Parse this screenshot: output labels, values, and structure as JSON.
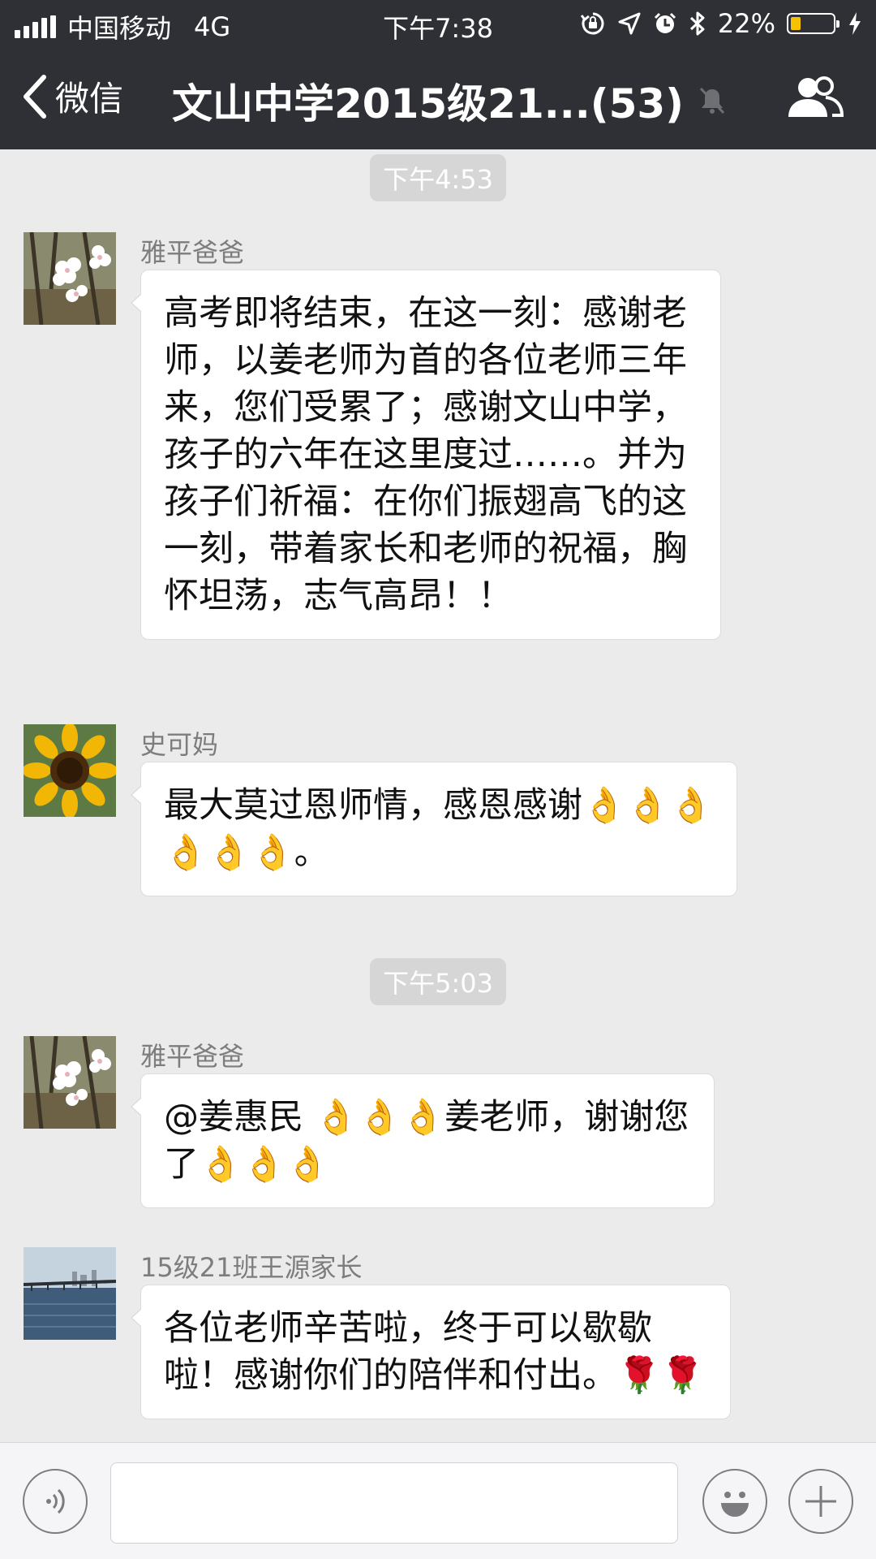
{
  "status_bar": {
    "carrier": "中国移动",
    "network": "4G",
    "time": "下午7:38",
    "battery": "22%",
    "battery_level": 0.22
  },
  "nav": {
    "back_label": "微信",
    "title": "文山中学2015级21...(53)"
  },
  "chat": {
    "timestamps": [
      "下午4:53",
      "下午5:03"
    ],
    "messages": [
      {
        "sender": "雅平爸爸",
        "text": "高考即将结束，在这一刻：感谢老师，以姜老师为首的各位老师三年来，您们受累了；感谢文山中学，孩子的六年在这里度过……。并为孩子们祈福：在你们振翅高飞的这一刻，带着家长和老师的祝福，胸怀坦荡，志气高昂！！",
        "avatar": "white-blossom"
      },
      {
        "sender": "史可妈",
        "text": "最大莫过恩师情，感恩感谢👌👌👌👌👌👌。",
        "avatar": "sunflower"
      },
      {
        "sender": "雅平爸爸",
        "text": "@姜惠民 👌👌👌姜老师，谢谢您了👌👌👌",
        "avatar": "white-blossom"
      },
      {
        "sender": "15级21班王源家长",
        "text": "各位老师辛苦啦，终于可以歇歇啦！感谢你们的陪伴和付出。🌹🌹",
        "avatar": "seaside-pier"
      }
    ]
  },
  "icons": {
    "status": [
      "signal-icon",
      "rotation-lock-icon",
      "location-icon",
      "alarm-icon",
      "bluetooth-icon",
      "battery-icon",
      "charging-icon"
    ],
    "nav": [
      "back-chevron-icon",
      "mute-bell-icon",
      "group-members-icon"
    ],
    "input": [
      "voice-icon",
      "emoji-icon",
      "plus-icon"
    ]
  },
  "colors": {
    "header_bg": "#2f3035",
    "chat_bg": "#ebebeb",
    "bubble_bg": "#ffffff",
    "timestamp_bg": "#d6d6d6",
    "battery_fill": "#f5c200"
  }
}
